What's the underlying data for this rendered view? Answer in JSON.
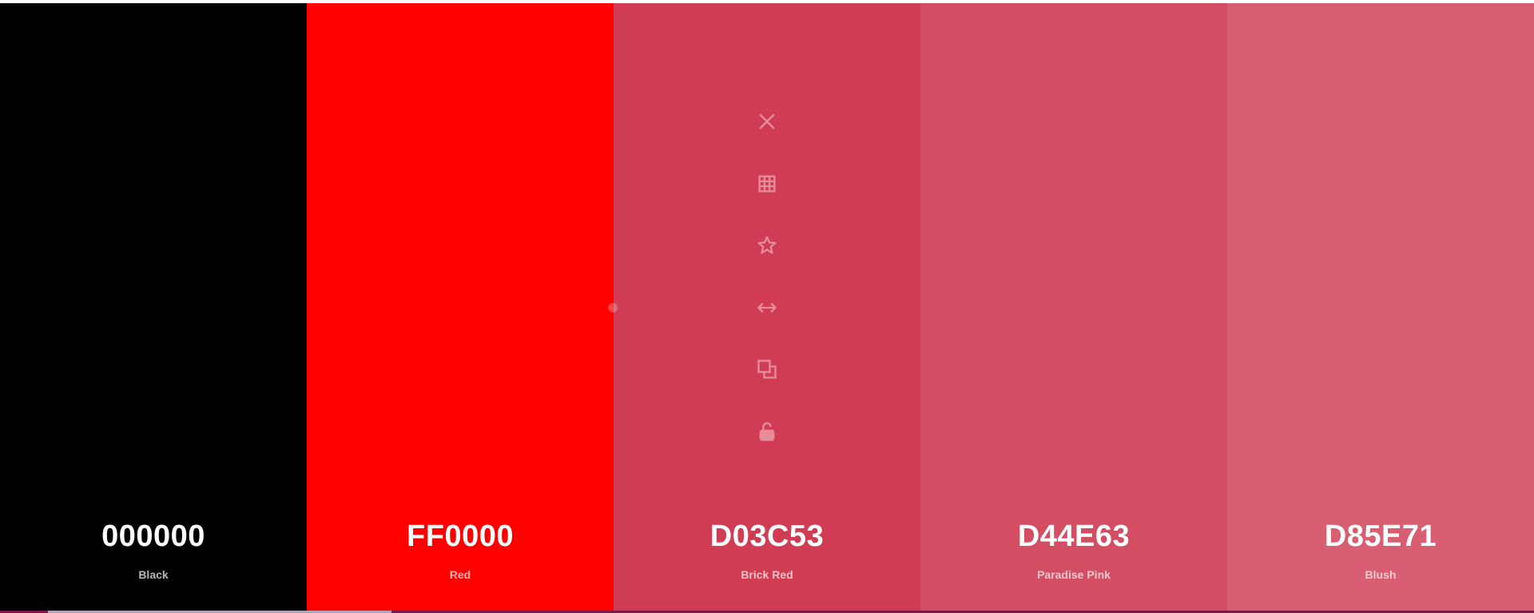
{
  "colors": {
    "black": "#000000",
    "red": "#FF0000",
    "brick_red": "#D03C53",
    "paradise_pink": "#D44E63",
    "blush": "#D85E71"
  },
  "swatches": [
    {
      "hex": "000000",
      "name": "Black",
      "bg": "#000000",
      "hex_color": "#ffffff",
      "name_color": "#b8b8b8"
    },
    {
      "hex": "FF0000",
      "name": "Red",
      "bg": "#FF0000",
      "hex_color": "#ffffff",
      "name_color": "#ffb3b3"
    },
    {
      "hex": "D03C53",
      "name": "Brick Red",
      "bg": "#D03C53",
      "hex_color": "#ffffff",
      "name_color": "#f1c2c9"
    },
    {
      "hex": "D44E63",
      "name": "Paradise Pink",
      "bg": "#D44E63",
      "hex_color": "#ffffff",
      "name_color": "#f2c6cd"
    },
    {
      "hex": "D85E71",
      "name": "Blush",
      "bg": "#D85E71",
      "hex_color": "#ffffff",
      "name_color": "#f4ccd2"
    }
  ],
  "hover_tools": [
    {
      "icon": "close-icon"
    },
    {
      "icon": "shades-grid-icon"
    },
    {
      "icon": "star-icon"
    },
    {
      "icon": "drag-arrows-icon"
    },
    {
      "icon": "copy-icon"
    },
    {
      "icon": "unlock-icon"
    }
  ]
}
